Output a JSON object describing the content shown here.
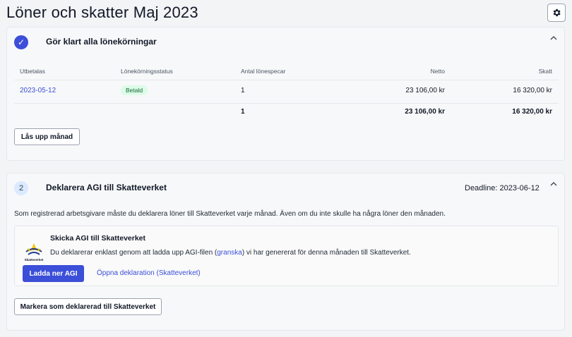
{
  "page": {
    "title": "Löner och skatter Maj 2023"
  },
  "icons": {
    "settings": "gear-icon",
    "check": "check-icon",
    "collapse": "chevron-up-icon",
    "brand": "skatteverket-logo"
  },
  "colors": {
    "accent": "#3b4fd8",
    "badge_bg": "#dcfce7",
    "badge_text": "#166534"
  },
  "step1": {
    "title": "Gör klart alla lönekörningar",
    "table": {
      "headers": [
        "Utbetalas",
        "Lönekörningsstatus",
        "Antal lönespecar",
        "Netto",
        "Skatt"
      ],
      "rows": [
        {
          "date": "2023-05-12",
          "status": "Betald",
          "count": "1",
          "netto": "23 106,00 kr",
          "skatt": "16 320,00 kr"
        }
      ],
      "totals": {
        "count": "1",
        "netto": "23 106,00 kr",
        "skatt": "16 320,00 kr"
      }
    },
    "unlock_label": "Lås upp månad"
  },
  "step2": {
    "number": "2",
    "title": "Deklarera AGI till Skatteverket",
    "deadline": "Deadline: 2023-06-12",
    "description": "Som registrerad arbetsgivare måste du deklarera löner till Skatteverket varje månad. Även om du inte skulle ha några löner den månaden.",
    "agi": {
      "logo_text": "Skatteverket",
      "title": "Skicka AGI till Skatteverket",
      "text_before": "Du deklarerar enklast genom att ladda upp AGI-filen (",
      "review_link": "granska",
      "text_after": ") vi har genererat för denna månaden till Skatteverket.",
      "download_label": "Ladda ner AGI",
      "open_link": "Öppna deklaration (Skatteverket)"
    },
    "mark_label": "Markera som deklarerad till Skatteverket"
  }
}
